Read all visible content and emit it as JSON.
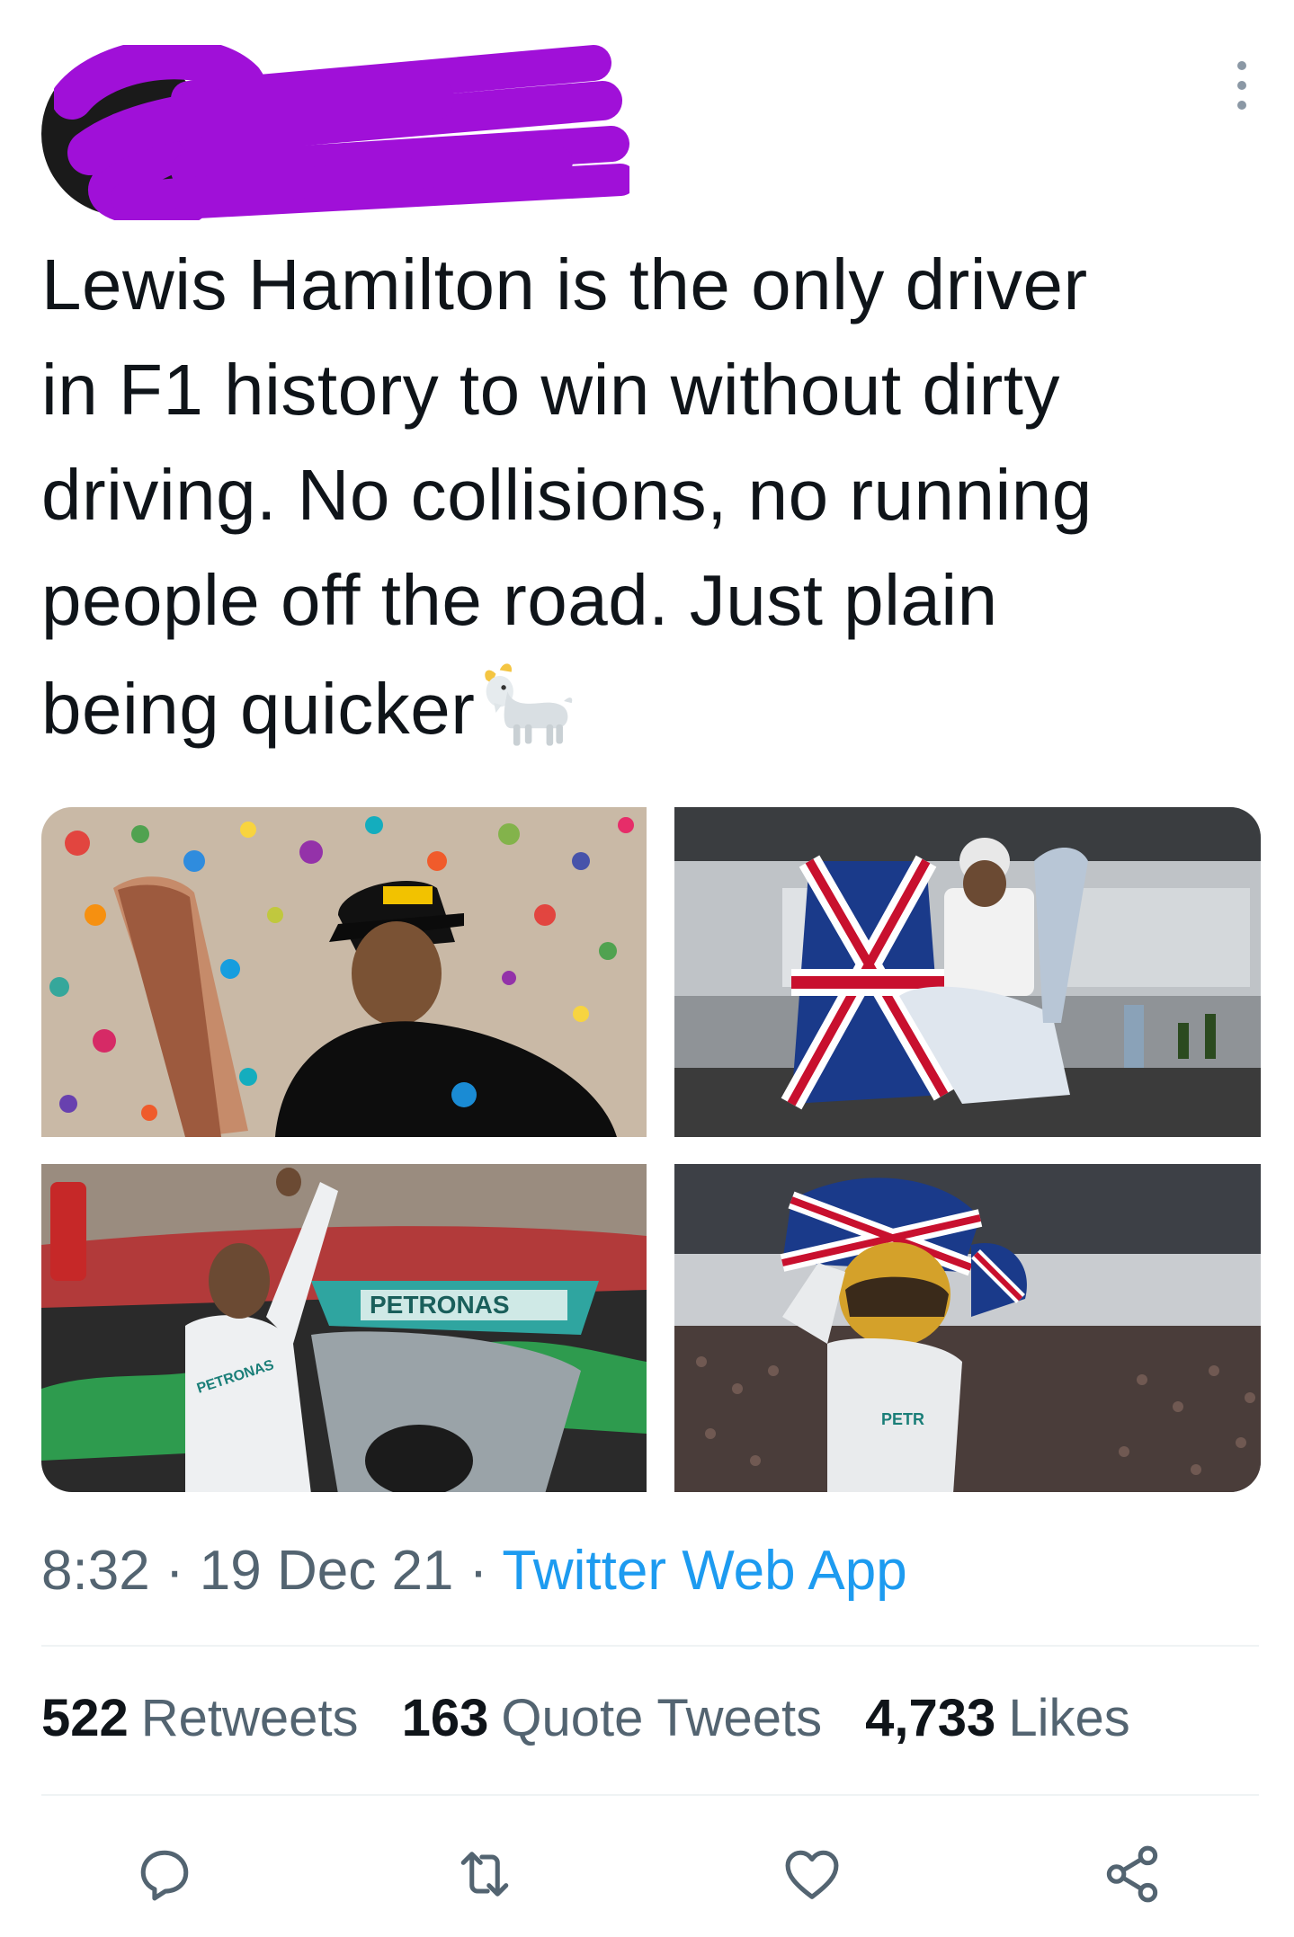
{
  "tweet": {
    "text": "Lewis Hamilton is the only driver\nin F1 history to win without dirty\ndriving. No collisions, no running\npeople off the road. Just plain\nbeing quicker",
    "emoji": "goat-emoji"
  },
  "meta": {
    "time": "8:32",
    "sep1": " · ",
    "date": "19 Dec 21",
    "sep2": " · ",
    "app": "Twitter Web App"
  },
  "stats": {
    "retweets_count": "522",
    "retweets_label": "Retweets",
    "quotes_count": "163",
    "quotes_label": "Quote Tweets",
    "likes_count": "4,733",
    "likes_label": "Likes"
  },
  "photos": {
    "p3_sponsor": "PETRONAS",
    "p3_suit": "PETRONAS",
    "p4_suit": "PETR"
  },
  "colors": {
    "link": "#1d9bf0",
    "secondary": "#536471",
    "redaction": "#a010d8"
  }
}
